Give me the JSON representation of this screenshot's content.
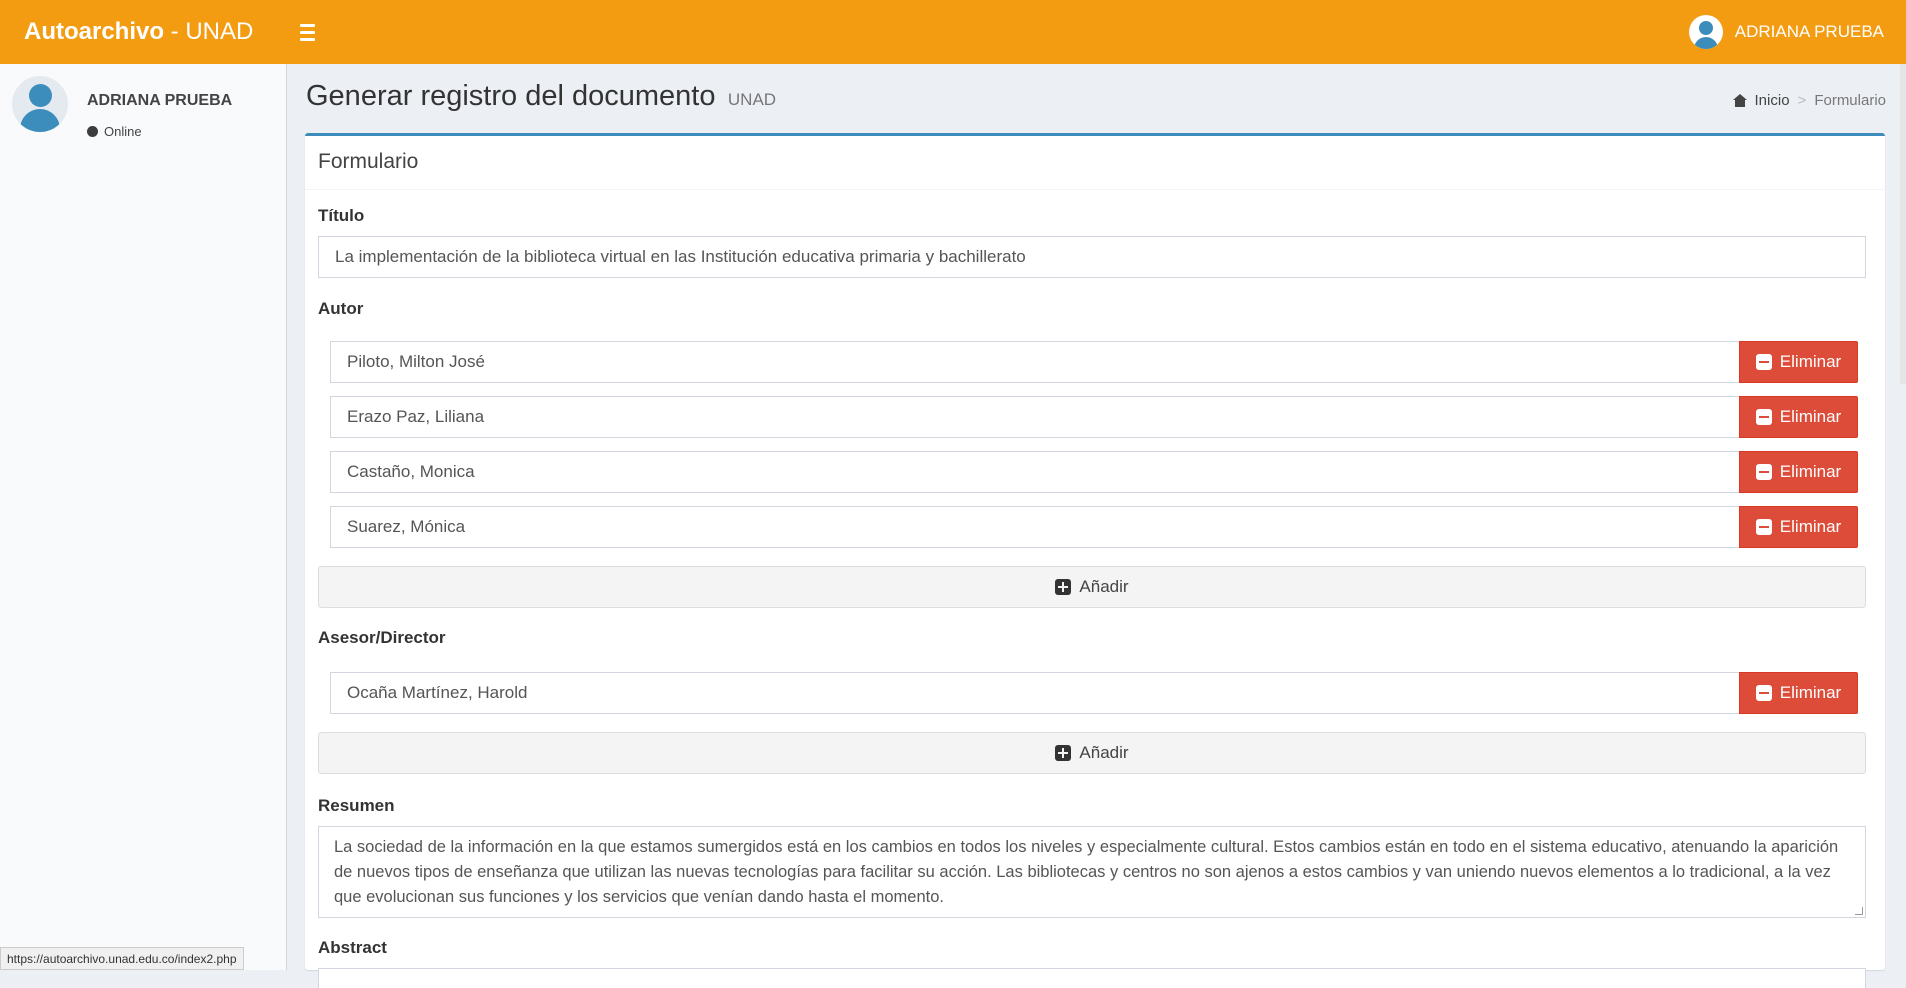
{
  "app": {
    "brand_bold": "Autoarchivo",
    "brand_light": " - UNAD"
  },
  "topbar": {
    "user_name": "ADRIANA PRUEBA"
  },
  "sidebar": {
    "user_name": "ADRIANA PRUEBA",
    "status": "Online"
  },
  "header": {
    "title": "Generar registro del documento",
    "subtitle": "UNAD",
    "breadcrumb": {
      "home": "Inicio",
      "current": "Formulario"
    }
  },
  "form": {
    "box_title": "Formulario",
    "titulo_label": "Título",
    "titulo_value": "La implementación de la biblioteca virtual en las Institución educativa primaria y bachillerato",
    "autor_label": "Autor",
    "autores": [
      "Piloto, Milton José",
      "Erazo Paz, Liliana",
      "Castaño, Monica",
      "Suarez, Mónica"
    ],
    "eliminar_label": "Eliminar",
    "anadir_label": "Añadir",
    "asesor_label": "Asesor/Director",
    "asesores": [
      "Ocaña Martínez, Harold"
    ],
    "resumen_label": "Resumen",
    "resumen_value": "La sociedad de la información en la que estamos sumergidos está en los cambios en todos los niveles y especialmente cultural. Estos cambios están en todo en el sistema educativo, atenuando la aparición de nuevos tipos de enseñanza que utilizan las nuevas tecnologías para facilitar su acción. Las bibliotecas y centros no son ajenos a estos cambios y van uniendo nuevos elementos a lo tradicional, a la vez que evolucionan sus funciones y los servicios que venían dando hasta el momento.",
    "abstract_label": "Abstract"
  },
  "statusbar": {
    "url": "https://autoarchivo.unad.edu.co/index2.php"
  },
  "colors": {
    "topbar": "#f39c12",
    "danger": "#dd4b39",
    "primary": "#3c8dbc"
  }
}
